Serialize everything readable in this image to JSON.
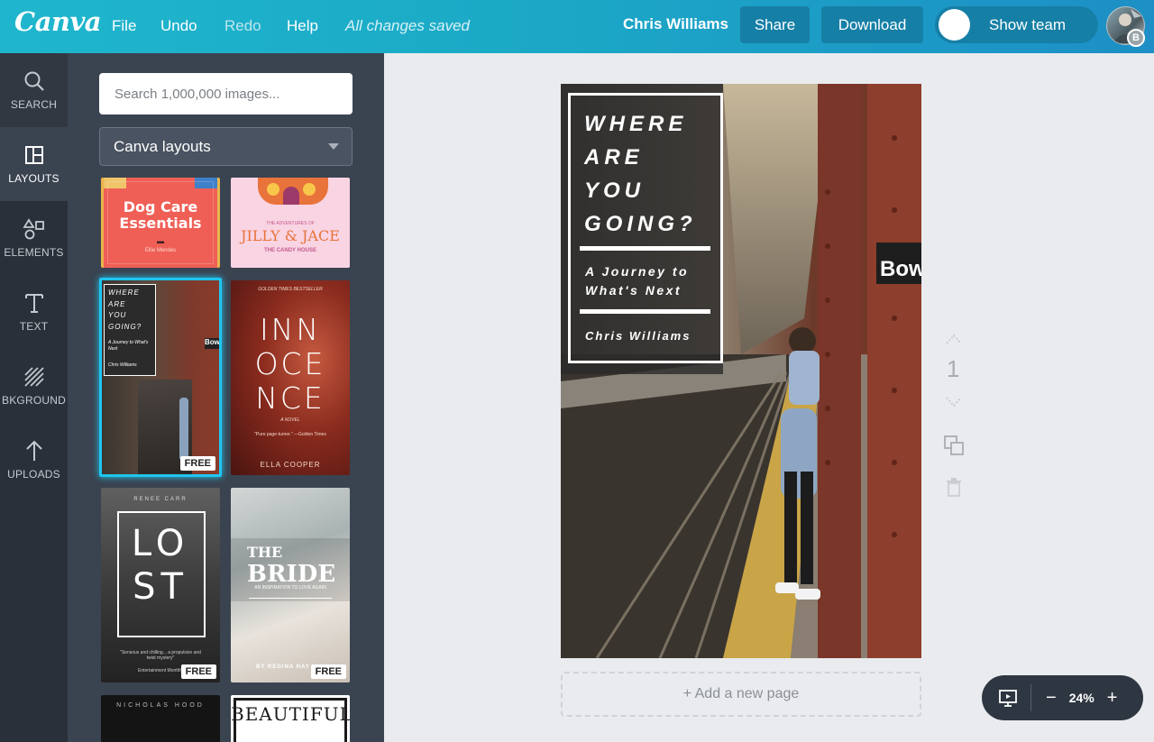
{
  "topbar": {
    "logo": "Canva",
    "menu": {
      "file": "File",
      "undo": "Undo",
      "redo": "Redo",
      "help": "Help"
    },
    "status": "All changes saved",
    "user_name": "Chris Williams",
    "share_label": "Share",
    "download_label": "Download",
    "show_team_label": "Show team",
    "avatar_initial": "B"
  },
  "rail": {
    "items": [
      {
        "label": "SEARCH",
        "icon": "search-icon"
      },
      {
        "label": "LAYOUTS",
        "icon": "layouts-icon"
      },
      {
        "label": "ELEMENTS",
        "icon": "elements-icon"
      },
      {
        "label": "TEXT",
        "icon": "text-icon"
      },
      {
        "label": "BKGROUND",
        "icon": "background-icon"
      },
      {
        "label": "UPLOADS",
        "icon": "upload-icon"
      }
    ]
  },
  "panel": {
    "search_placeholder": "Search 1,000,000 images...",
    "select_value": "Canva layouts",
    "free_badge": "FREE",
    "layouts": [
      {
        "title": "Dog Care Essentials",
        "author": "Ellie Mendes"
      },
      {
        "kicker": "THE ADVENTURES OF",
        "title": "JILLY & JACE",
        "subtitle": "THE CANDY HOUSE"
      },
      {
        "title_lines": [
          "WHERE",
          "ARE",
          "YOU",
          "GOING?"
        ],
        "subtitle": "A Journey to What's Next",
        "author": "Chris Williams"
      },
      {
        "kicker": "GOLDEN TIMES BESTSELLER",
        "title_lines": [
          "INN",
          "OCE",
          "NCE"
        ],
        "subtitle": "A NOVEL",
        "quote": "\"Pure page-turner.\" —Golden Times",
        "author": "ELLA COOPER"
      },
      {
        "author": "RENEE CARR",
        "title_lines": [
          "LO",
          "ST"
        ],
        "quote": "\"Sensous and chilling... a propulsive and twist mystery\"",
        "source": "Entertainment Monthly"
      },
      {
        "title_lines": [
          "THE",
          "BRIDE"
        ],
        "subtitle": "AN INSPIRATION TO LOVE AGAIN",
        "author": "BY REGINA HAY"
      },
      {
        "author": "NICHOLAS HOOD"
      },
      {
        "title": "BEAUTIFUL"
      }
    ]
  },
  "design": {
    "title_lines": [
      "WHERE",
      "ARE",
      "YOU",
      "GOING?"
    ],
    "subtitle_lines": [
      "A Journey to",
      "What's Next"
    ],
    "author": "Chris Williams",
    "sign_text": "Bow"
  },
  "canvas": {
    "add_page": "+ Add a new page",
    "page_number": "1"
  },
  "zoom": {
    "minus": "−",
    "value": "24%",
    "plus": "+"
  },
  "colors": {
    "topbar": "#1fb6cd",
    "rail": "#293039",
    "panel": "#3a4350",
    "selection": "#1fc6f0"
  }
}
